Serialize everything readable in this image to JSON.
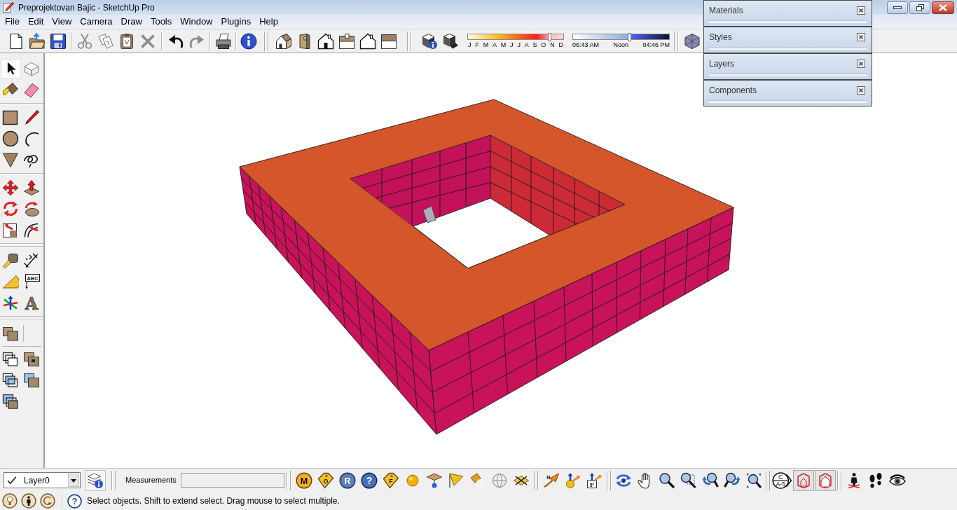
{
  "window": {
    "title": "Preprojektovan Bajic - SketchUp Pro"
  },
  "menu": [
    "File",
    "Edit",
    "View",
    "Camera",
    "Draw",
    "Tools",
    "Window",
    "Plugins",
    "Help"
  ],
  "shadow_settings": {
    "date_slider": {
      "level": 0.86,
      "ticks": [
        "J",
        "F",
        "M",
        "A",
        "M",
        "J",
        "J",
        "A",
        "S",
        "O",
        "N",
        "D"
      ]
    },
    "time_slider": {
      "level": 0.59,
      "ticks": [
        "06:43 AM",
        "Noon",
        "04:46 PM"
      ]
    }
  },
  "panels": [
    {
      "title": "Materials"
    },
    {
      "title": "Styles"
    },
    {
      "title": "Layers"
    },
    {
      "title": "Components"
    }
  ],
  "tool_palette": [
    {
      "selected": true
    },
    {
      "selected": false
    },
    {
      "selected": false
    },
    {
      "selected": false
    },
    {
      "selected": false
    },
    {
      "selected": false
    },
    {
      "selected": false
    },
    {
      "selected": false
    },
    {
      "selected": false
    },
    {
      "selected": false
    },
    {
      "selected": false
    },
    {
      "selected": false
    },
    {
      "selected": false
    },
    {
      "selected": false
    },
    {
      "selected": false
    },
    {
      "selected": false
    },
    {
      "selected": false
    },
    {
      "selected": false
    },
    {
      "selected": false
    },
    {
      "selected": false,
      "glyph": "ABC"
    },
    {
      "selected": false
    },
    {
      "selected": false,
      "glyph": "A"
    },
    {
      "selected": false
    },
    {
      "selected": false
    },
    {
      "selected": false
    },
    {
      "selected": false
    },
    {
      "selected": false
    },
    {
      "selected": false
    }
  ],
  "layer_toolbar": {
    "current_layer": "Layer0"
  },
  "measurements": {
    "label": "Measurements"
  },
  "plugin_toolbar": {
    "glyphs": [
      "M",
      "O",
      "R",
      "?",
      "F"
    ]
  },
  "location_toolbar": {
    "glyphs": [
      "N",
      "5°"
    ]
  },
  "section_toolbar": {
    "glyphs": [
      "C",
      "A-5"
    ],
    "toggles": [
      {
        "pressed": true
      },
      {
        "pressed": true
      }
    ]
  },
  "status_bar": {
    "help_glyph": "?",
    "text": "Select objects. Shift to extend select. Drag mouse to select multiple."
  }
}
